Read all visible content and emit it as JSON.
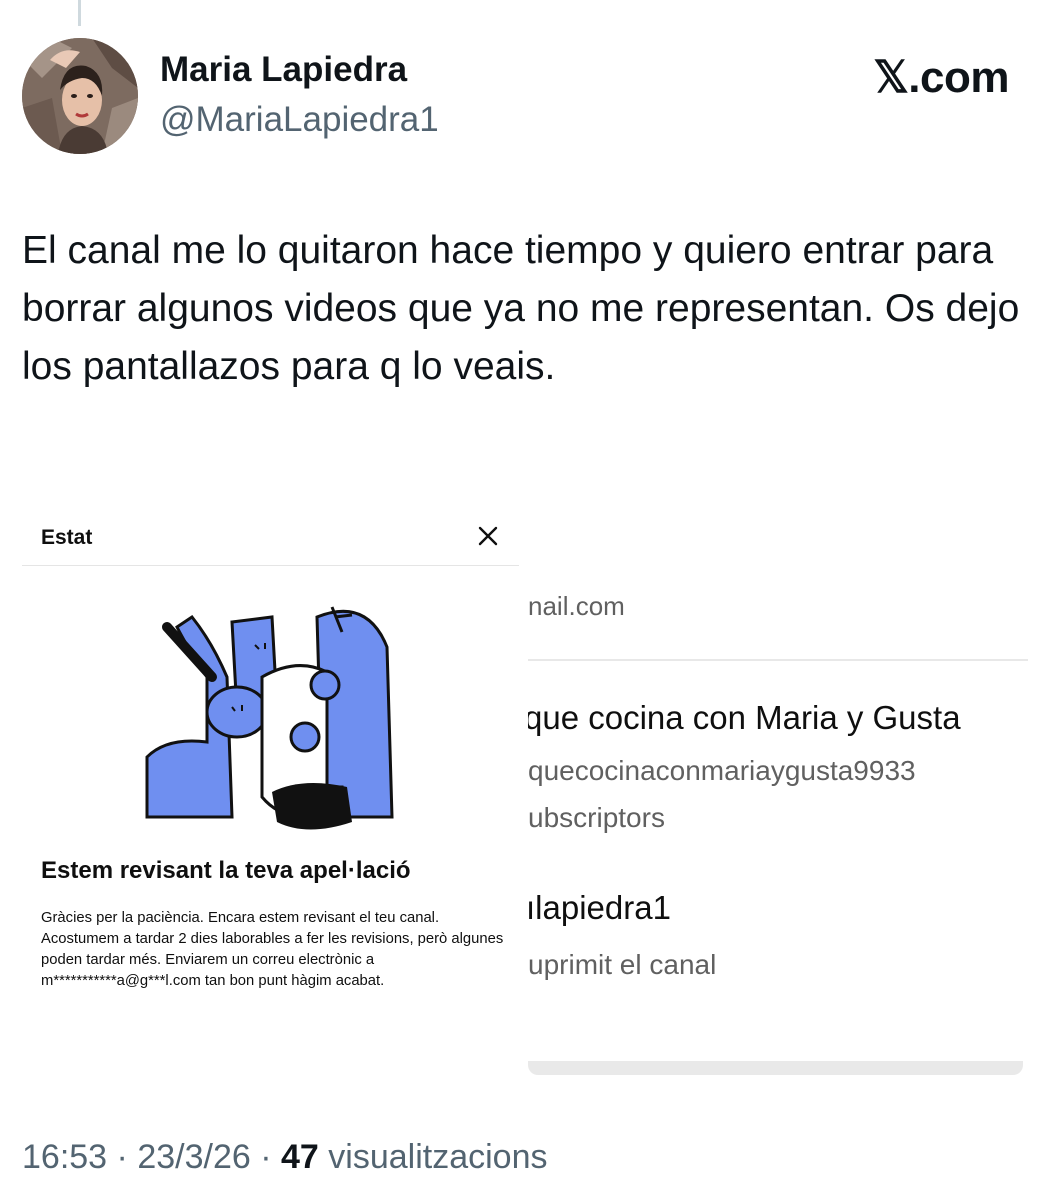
{
  "author": {
    "display_name": "Maria Lapiedra",
    "handle": "@MariaLapiedra1"
  },
  "brand": "𝕏.com",
  "tweet": {
    "text": "El canal me lo quitaron hace tiempo y quiero entrar para borrar algunos videos que ya no me representan. Os dejo los pantallazos para q lo veais."
  },
  "screenshot_left": {
    "title": "Estat",
    "heading": "Estem revisant la teva apel·lació",
    "body": "Gràcies per la paciència. Encara estem revisant el teu canal. Acostumem a tardar 2 dies laborables a fer les revisions, però algunes poden tardar més. Enviarem un correu electrònic a m***********a@g***l.com tan bon punt hàgim acabat."
  },
  "screenshot_right": {
    "email_fragment": "nail.com",
    "channel_name": "que cocina con Maria y Gusta",
    "channel_handle": "quecocinaconmariaygusta9933",
    "subscribers": "ubscriptors",
    "username": "ılapiedra1",
    "status": "uprimit el canal"
  },
  "meta": {
    "time": "16:53",
    "separator": "·",
    "date": "23/3/26",
    "views_count": "47",
    "views_label": "visualitzacions"
  },
  "colors": {
    "illustration_blue": "#6f8ff0",
    "secondary_text": "#536471"
  }
}
